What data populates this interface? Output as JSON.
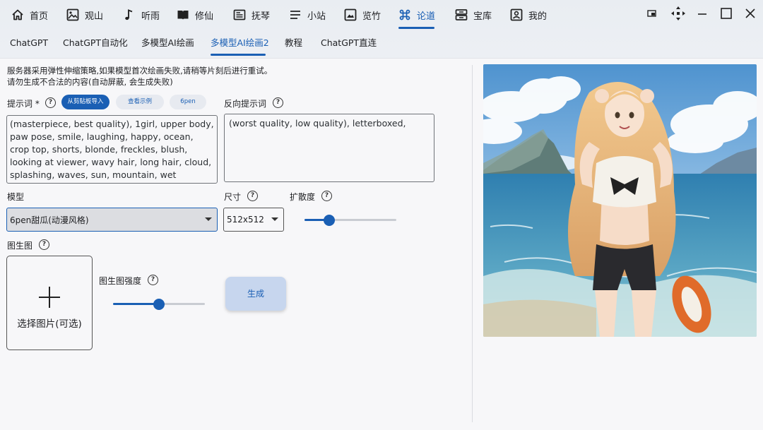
{
  "nav": {
    "items": [
      {
        "label": "首页",
        "icon": "home-icon"
      },
      {
        "label": "观山",
        "icon": "picture-icon"
      },
      {
        "label": "听雨",
        "icon": "music-note-icon"
      },
      {
        "label": "修仙",
        "icon": "book-icon"
      },
      {
        "label": "抚琴",
        "icon": "newspaper-icon"
      },
      {
        "label": "小站",
        "icon": "menu-lines-icon"
      },
      {
        "label": "览竹",
        "icon": "image-frame-icon"
      },
      {
        "label": "论道",
        "icon": "command-icon"
      },
      {
        "label": "宝库",
        "icon": "storage-icon"
      },
      {
        "label": "我的",
        "icon": "user-card-icon"
      }
    ],
    "active_index": 7
  },
  "subtabs": {
    "items": [
      "ChatGPT",
      "ChatGPT自动化",
      "多模型AI绘画",
      "多模型AI绘画2",
      "教程",
      "ChatGPT直连"
    ],
    "active_index": 3
  },
  "notice": {
    "line1": "服务器采用弹性伸缩策略,如果模型首次绘画失败,请稍等片刻后进行重试。",
    "line2": "请勿生成不合法的内容(自动屏蔽, 会生成失败)"
  },
  "prompt": {
    "label": "提示词 *",
    "import_button": "从剪贴板导入",
    "example_button": "查看示例",
    "tag_button": "6pen",
    "value": "(masterpiece, best quality), 1girl, upper body, paw pose, smile, laughing, happy, ocean, crop top, shorts, blonde, freckles, blush, looking at viewer, wavy hair, long hair, cloud, splashing, waves, sun, mountain, wet"
  },
  "negative_prompt": {
    "label": "反向提示词",
    "value": "(worst quality, low quality), letterboxed,"
  },
  "model": {
    "label": "模型",
    "selected": "6pen甜瓜(动漫风格)"
  },
  "size": {
    "label": "尺寸",
    "selected": "512x512"
  },
  "diffusion": {
    "label": "扩散度",
    "value": 0.27
  },
  "img2img": {
    "label": "图生图",
    "upload_text": "选择图片(可选)",
    "strength_label": "图生图强度",
    "strength": 0.5
  },
  "generate_button": "生成",
  "colors": {
    "accent": "#1a5fb4",
    "button_light": "#c7d6ee"
  }
}
